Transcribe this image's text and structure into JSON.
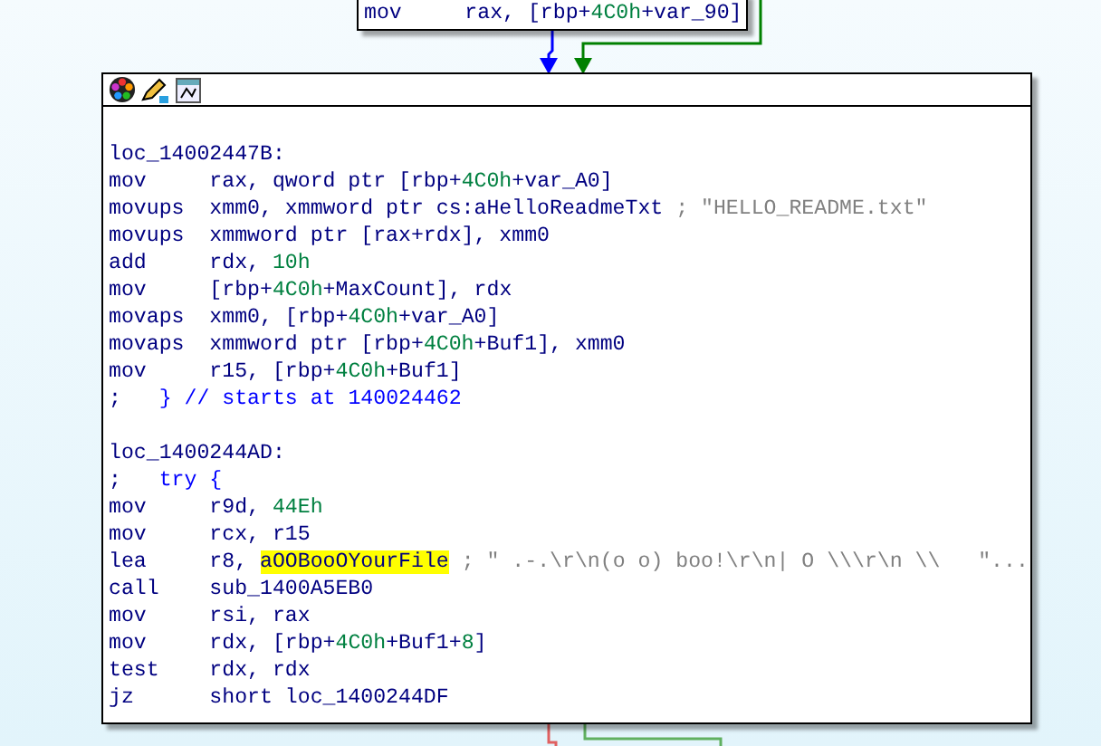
{
  "top_block": {
    "lines": [
      {
        "kind": "instr",
        "mnemonic": "mov",
        "operands": [
          {
            "text": "rax, [rbp+",
            "kind": "plain"
          },
          {
            "text": "4C0h",
            "kind": "number"
          },
          {
            "text": "+var_90]",
            "kind": "plain"
          }
        ]
      }
    ]
  },
  "block": {
    "lines": [
      {
        "kind": "blank"
      },
      {
        "kind": "label",
        "text": "loc_14002447B:"
      },
      {
        "kind": "instr",
        "mnemonic": "mov",
        "operands": [
          {
            "text": "rax, qword ptr [rbp+",
            "kind": "plain"
          },
          {
            "text": "4C0h",
            "kind": "number"
          },
          {
            "text": "+var_A0]",
            "kind": "plain"
          }
        ]
      },
      {
        "kind": "instr",
        "mnemonic": "movups",
        "operands": [
          {
            "text": "xmm0, xmmword ptr cs:aHelloReadmeTxt ",
            "kind": "plain"
          },
          {
            "text": "; \"HELLO_README.txt\"",
            "kind": "comment"
          }
        ]
      },
      {
        "kind": "instr",
        "mnemonic": "movups",
        "operands": [
          {
            "text": "xmmword ptr [rax+rdx], xmm0",
            "kind": "plain"
          }
        ]
      },
      {
        "kind": "instr",
        "mnemonic": "add",
        "operands": [
          {
            "text": "rdx, ",
            "kind": "plain"
          },
          {
            "text": "10h",
            "kind": "number"
          }
        ]
      },
      {
        "kind": "instr",
        "mnemonic": "mov",
        "operands": [
          {
            "text": "[rbp+",
            "kind": "plain"
          },
          {
            "text": "4C0h",
            "kind": "number"
          },
          {
            "text": "+MaxCount], rdx",
            "kind": "plain"
          }
        ]
      },
      {
        "kind": "instr",
        "mnemonic": "movaps",
        "operands": [
          {
            "text": "xmm0, [rbp+",
            "kind": "plain"
          },
          {
            "text": "4C0h",
            "kind": "number"
          },
          {
            "text": "+var_A0]",
            "kind": "plain"
          }
        ]
      },
      {
        "kind": "instr",
        "mnemonic": "movaps",
        "operands": [
          {
            "text": "xmmword ptr [rbp+",
            "kind": "plain"
          },
          {
            "text": "4C0h",
            "kind": "number"
          },
          {
            "text": "+Buf1], xmm0",
            "kind": "plain"
          }
        ]
      },
      {
        "kind": "instr",
        "mnemonic": "mov",
        "operands": [
          {
            "text": "r15, [rbp+",
            "kind": "plain"
          },
          {
            "text": "4C0h",
            "kind": "number"
          },
          {
            "text": "+Buf1]",
            "kind": "plain"
          }
        ]
      },
      {
        "kind": "note",
        "prefix": ";",
        "text": "   } // starts at 140024462"
      },
      {
        "kind": "blank"
      },
      {
        "kind": "label",
        "text": "loc_1400244AD:"
      },
      {
        "kind": "note",
        "prefix": ";",
        "text": "   try {"
      },
      {
        "kind": "instr",
        "mnemonic": "mov",
        "operands": [
          {
            "text": "r9d, ",
            "kind": "plain"
          },
          {
            "text": "44Eh",
            "kind": "number"
          }
        ]
      },
      {
        "kind": "instr",
        "mnemonic": "mov",
        "operands": [
          {
            "text": "rcx, r15",
            "kind": "plain"
          }
        ]
      },
      {
        "kind": "instr",
        "mnemonic": "lea",
        "operands": [
          {
            "text": "r8, ",
            "kind": "plain"
          },
          {
            "text": "aOOBooOYourFile",
            "kind": "highlight"
          },
          {
            "text": " ; \" .-.\\r\\n(o o) boo!\\r\\n| O \\\\\\r\\n \\\\   \"...",
            "kind": "comment"
          }
        ]
      },
      {
        "kind": "instr",
        "mnemonic": "call",
        "operands": [
          {
            "text": "sub_1400A5EB0",
            "kind": "plain"
          }
        ]
      },
      {
        "kind": "instr",
        "mnemonic": "mov",
        "operands": [
          {
            "text": "rsi, rax",
            "kind": "plain"
          }
        ]
      },
      {
        "kind": "instr",
        "mnemonic": "mov",
        "operands": [
          {
            "text": "rdx, [rbp+",
            "kind": "plain"
          },
          {
            "text": "4C0h",
            "kind": "number"
          },
          {
            "text": "+Buf1+",
            "kind": "plain"
          },
          {
            "text": "8",
            "kind": "number"
          },
          {
            "text": "]",
            "kind": "plain"
          }
        ]
      },
      {
        "kind": "instr",
        "mnemonic": "test",
        "operands": [
          {
            "text": "rdx, rdx",
            "kind": "plain"
          }
        ]
      },
      {
        "kind": "instr",
        "mnemonic": "jz",
        "operands": [
          {
            "text": "short loc_1400244DF",
            "kind": "plain"
          }
        ]
      }
    ]
  }
}
